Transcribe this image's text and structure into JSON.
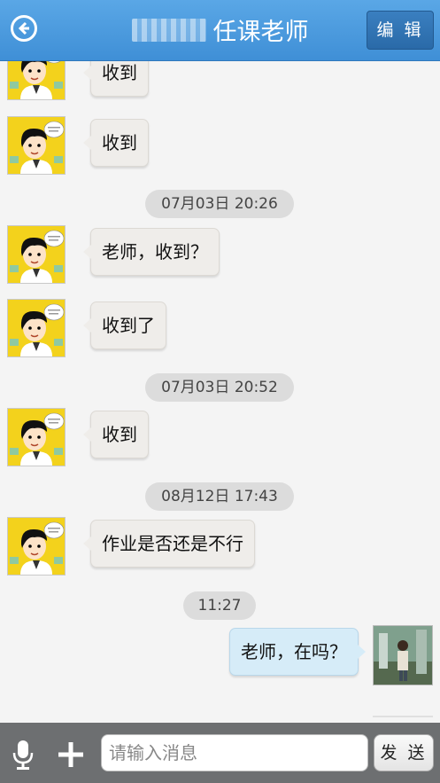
{
  "header": {
    "title": "任课老师",
    "edit_label": "编 辑"
  },
  "messages": [
    {
      "type": "in",
      "text": "收到"
    },
    {
      "type": "in",
      "text": "收到"
    },
    {
      "type": "time",
      "text": "07月03日 20:26"
    },
    {
      "type": "in",
      "text": "老师，收到？"
    },
    {
      "type": "in",
      "text": "收到了"
    },
    {
      "type": "time",
      "text": "07月03日 20:52"
    },
    {
      "type": "in",
      "text": "收到"
    },
    {
      "type": "time",
      "text": "08月12日 17:43"
    },
    {
      "type": "in",
      "text": "作业是否还是不行"
    },
    {
      "type": "time",
      "text": "11:27"
    },
    {
      "type": "out",
      "text": "老师，在吗？"
    }
  ],
  "composer": {
    "placeholder": "请输入消息",
    "send_label": "发 送"
  },
  "colors": {
    "header": "#4a9ae0",
    "incoming_bubble": "#efedea",
    "outgoing_bubble": "#d6ecf8",
    "bottom_bar": "#6d6f71"
  }
}
